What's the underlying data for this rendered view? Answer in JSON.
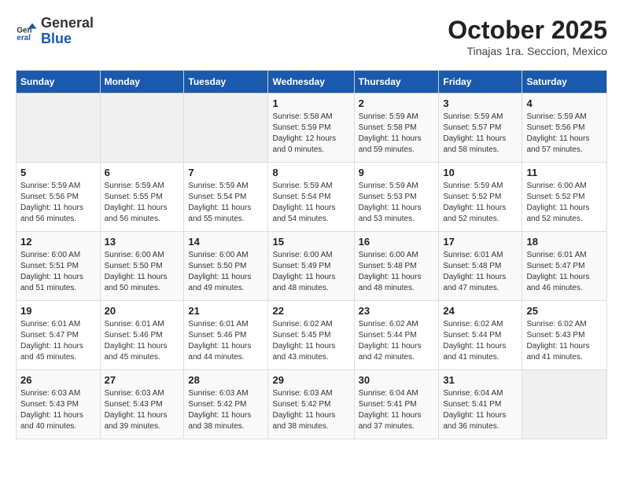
{
  "header": {
    "logo_general": "General",
    "logo_blue": "Blue",
    "month": "October 2025",
    "location": "Tinajas 1ra. Seccion, Mexico"
  },
  "weekdays": [
    "Sunday",
    "Monday",
    "Tuesday",
    "Wednesday",
    "Thursday",
    "Friday",
    "Saturday"
  ],
  "weeks": [
    [
      {
        "day": "",
        "info": ""
      },
      {
        "day": "",
        "info": ""
      },
      {
        "day": "",
        "info": ""
      },
      {
        "day": "1",
        "info": "Sunrise: 5:58 AM\nSunset: 5:59 PM\nDaylight: 12 hours\nand 0 minutes."
      },
      {
        "day": "2",
        "info": "Sunrise: 5:59 AM\nSunset: 5:58 PM\nDaylight: 11 hours\nand 59 minutes."
      },
      {
        "day": "3",
        "info": "Sunrise: 5:59 AM\nSunset: 5:57 PM\nDaylight: 11 hours\nand 58 minutes."
      },
      {
        "day": "4",
        "info": "Sunrise: 5:59 AM\nSunset: 5:56 PM\nDaylight: 11 hours\nand 57 minutes."
      }
    ],
    [
      {
        "day": "5",
        "info": "Sunrise: 5:59 AM\nSunset: 5:56 PM\nDaylight: 11 hours\nand 56 minutes."
      },
      {
        "day": "6",
        "info": "Sunrise: 5:59 AM\nSunset: 5:55 PM\nDaylight: 11 hours\nand 56 minutes."
      },
      {
        "day": "7",
        "info": "Sunrise: 5:59 AM\nSunset: 5:54 PM\nDaylight: 11 hours\nand 55 minutes."
      },
      {
        "day": "8",
        "info": "Sunrise: 5:59 AM\nSunset: 5:54 PM\nDaylight: 11 hours\nand 54 minutes."
      },
      {
        "day": "9",
        "info": "Sunrise: 5:59 AM\nSunset: 5:53 PM\nDaylight: 11 hours\nand 53 minutes."
      },
      {
        "day": "10",
        "info": "Sunrise: 5:59 AM\nSunset: 5:52 PM\nDaylight: 11 hours\nand 52 minutes."
      },
      {
        "day": "11",
        "info": "Sunrise: 6:00 AM\nSunset: 5:52 PM\nDaylight: 11 hours\nand 52 minutes."
      }
    ],
    [
      {
        "day": "12",
        "info": "Sunrise: 6:00 AM\nSunset: 5:51 PM\nDaylight: 11 hours\nand 51 minutes."
      },
      {
        "day": "13",
        "info": "Sunrise: 6:00 AM\nSunset: 5:50 PM\nDaylight: 11 hours\nand 50 minutes."
      },
      {
        "day": "14",
        "info": "Sunrise: 6:00 AM\nSunset: 5:50 PM\nDaylight: 11 hours\nand 49 minutes."
      },
      {
        "day": "15",
        "info": "Sunrise: 6:00 AM\nSunset: 5:49 PM\nDaylight: 11 hours\nand 48 minutes."
      },
      {
        "day": "16",
        "info": "Sunrise: 6:00 AM\nSunset: 5:48 PM\nDaylight: 11 hours\nand 48 minutes."
      },
      {
        "day": "17",
        "info": "Sunrise: 6:01 AM\nSunset: 5:48 PM\nDaylight: 11 hours\nand 47 minutes."
      },
      {
        "day": "18",
        "info": "Sunrise: 6:01 AM\nSunset: 5:47 PM\nDaylight: 11 hours\nand 46 minutes."
      }
    ],
    [
      {
        "day": "19",
        "info": "Sunrise: 6:01 AM\nSunset: 5:47 PM\nDaylight: 11 hours\nand 45 minutes."
      },
      {
        "day": "20",
        "info": "Sunrise: 6:01 AM\nSunset: 5:46 PM\nDaylight: 11 hours\nand 45 minutes."
      },
      {
        "day": "21",
        "info": "Sunrise: 6:01 AM\nSunset: 5:46 PM\nDaylight: 11 hours\nand 44 minutes."
      },
      {
        "day": "22",
        "info": "Sunrise: 6:02 AM\nSunset: 5:45 PM\nDaylight: 11 hours\nand 43 minutes."
      },
      {
        "day": "23",
        "info": "Sunrise: 6:02 AM\nSunset: 5:44 PM\nDaylight: 11 hours\nand 42 minutes."
      },
      {
        "day": "24",
        "info": "Sunrise: 6:02 AM\nSunset: 5:44 PM\nDaylight: 11 hours\nand 41 minutes."
      },
      {
        "day": "25",
        "info": "Sunrise: 6:02 AM\nSunset: 5:43 PM\nDaylight: 11 hours\nand 41 minutes."
      }
    ],
    [
      {
        "day": "26",
        "info": "Sunrise: 6:03 AM\nSunset: 5:43 PM\nDaylight: 11 hours\nand 40 minutes."
      },
      {
        "day": "27",
        "info": "Sunrise: 6:03 AM\nSunset: 5:43 PM\nDaylight: 11 hours\nand 39 minutes."
      },
      {
        "day": "28",
        "info": "Sunrise: 6:03 AM\nSunset: 5:42 PM\nDaylight: 11 hours\nand 38 minutes."
      },
      {
        "day": "29",
        "info": "Sunrise: 6:03 AM\nSunset: 5:42 PM\nDaylight: 11 hours\nand 38 minutes."
      },
      {
        "day": "30",
        "info": "Sunrise: 6:04 AM\nSunset: 5:41 PM\nDaylight: 11 hours\nand 37 minutes."
      },
      {
        "day": "31",
        "info": "Sunrise: 6:04 AM\nSunset: 5:41 PM\nDaylight: 11 hours\nand 36 minutes."
      },
      {
        "day": "",
        "info": ""
      }
    ]
  ]
}
